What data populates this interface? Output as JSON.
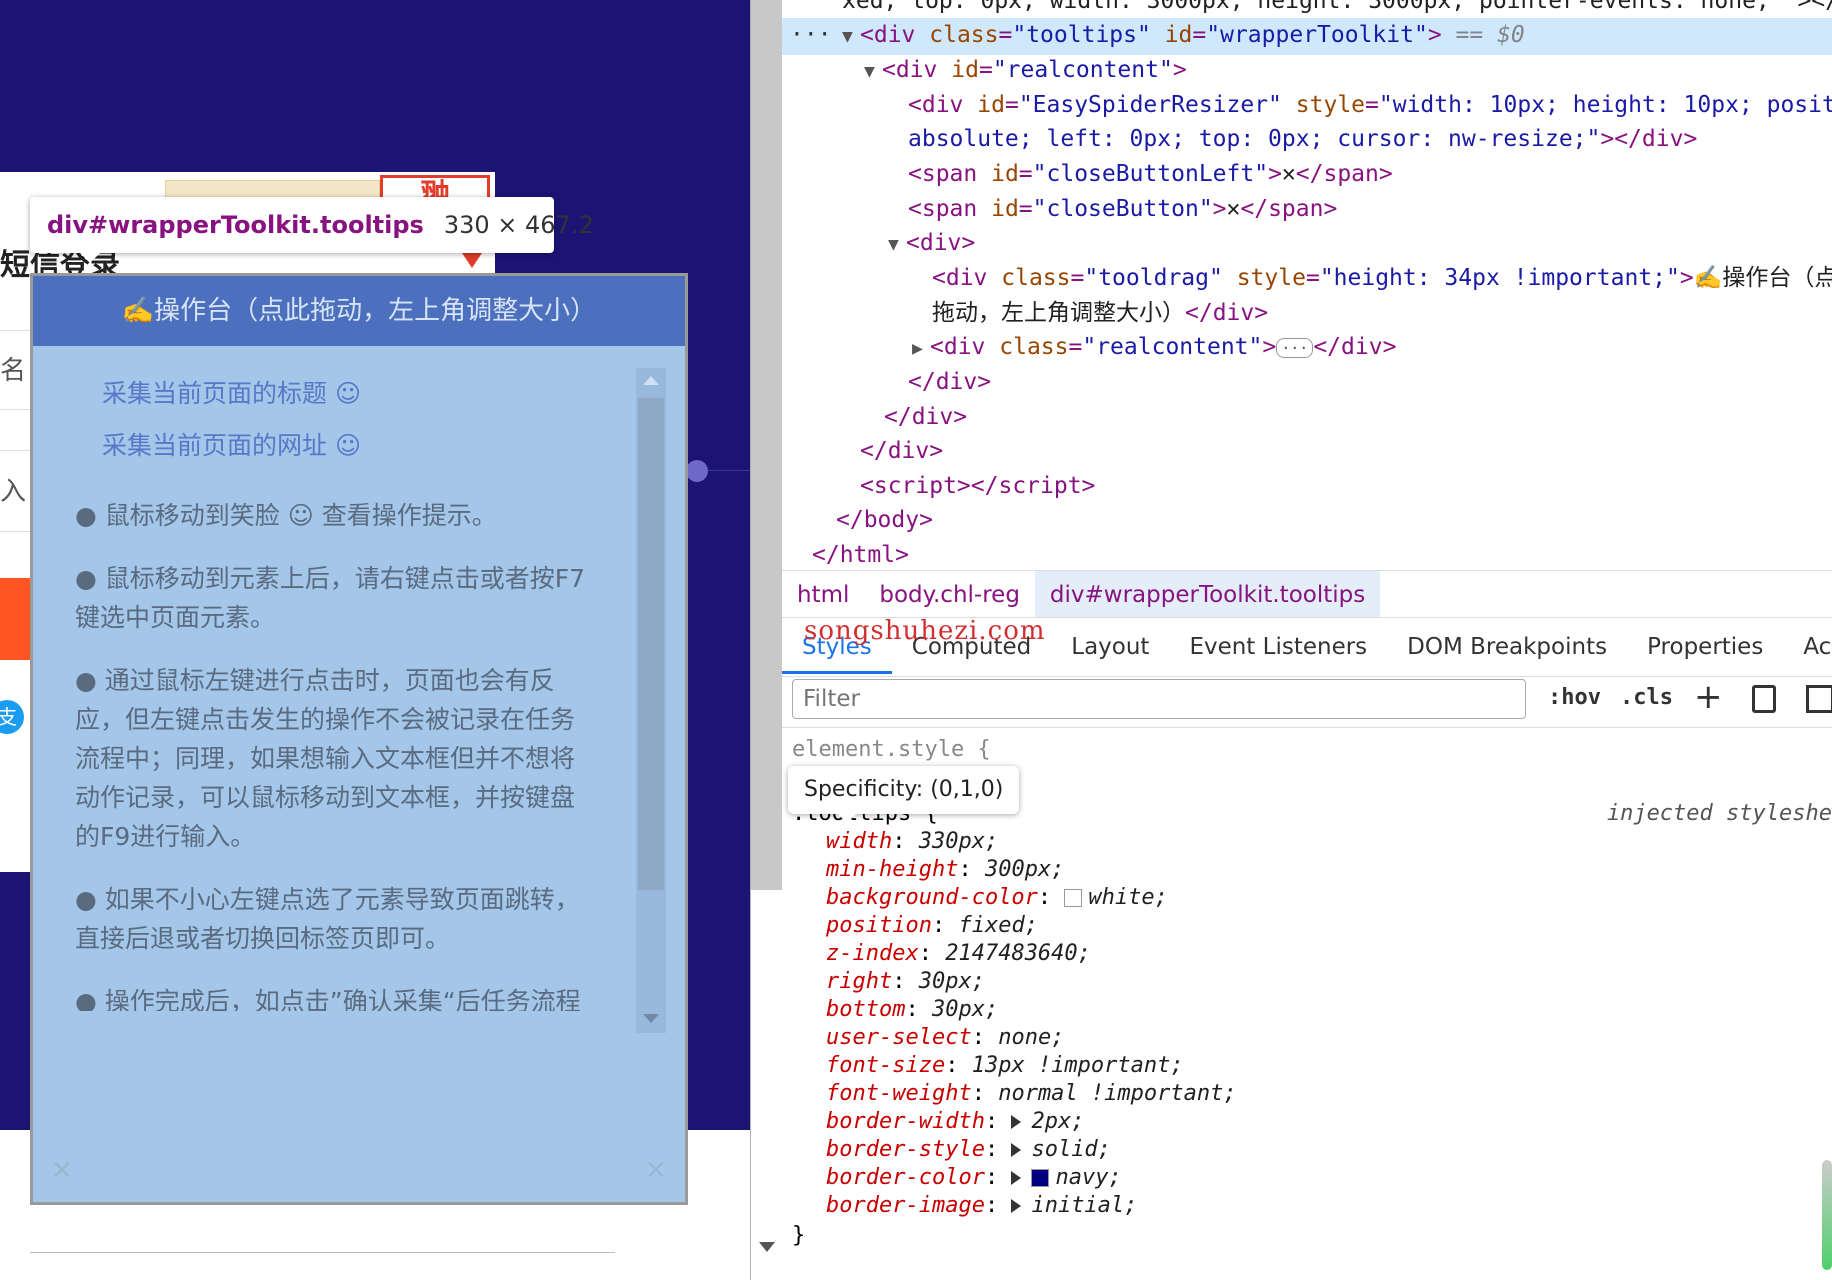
{
  "page": {
    "card_title": "短信登录",
    "logo_text": "翀",
    "input1_text": "名",
    "input2_text": "入",
    "badge_text": "支"
  },
  "hover_label": {
    "selector": "div#wrapperToolkit.tooltips",
    "dimensions": "330 × 467.2"
  },
  "toolkit": {
    "drag_title": "✍️操作台（点此拖动，左上角调整大小）",
    "links": [
      "采集当前页面的标题 ☺",
      "采集当前页面的网址 ☺"
    ],
    "paragraphs": [
      "● 鼠标移动到笑脸 ☺ 查看操作提示。",
      "● 鼠标移动到元素上后，请右键点击或者按F7键选中页面元素。",
      "● 通过鼠标左键进行点击时，页面也会有反应，但左键点击发生的操作不会被记录在任务流程中；同理，如果想输入文本框但并不想将动作记录，可以鼠标移动到文本框，并按键盘的F9进行输入。",
      "● 如果不小心左键点选了元素导致页面跳转，直接后退或者切换回标签页即可。",
      "● 操作完成后，如点击”确认采集“后任务流程图中没有”提取数据“操作被添加，重试一次即可。"
    ],
    "close_left": "✕",
    "close_right": "✕"
  },
  "dom": {
    "line0": "xed; top: 0px; width: 3000px; height: 3000px; pointer-events: none; \"></di",
    "sel_row_dots": "···",
    "sel_tag_open": "<div ",
    "sel_attr1_name": "class",
    "sel_attr1_val": "\"tooltips\"",
    "sel_attr2_name": "id",
    "sel_attr2_val": "\"wrapperToolkit\"",
    "sel_tag_close": ">",
    "sel_eq": " == $0",
    "realcontent_open": "<div ",
    "realcontent_attr": "id",
    "realcontent_val": "\"realcontent\"",
    "resizer_attr": "id",
    "resizer_val": "\"EasySpiderResizer\"",
    "resizer_style_name": "style",
    "resizer_style_val1": "\"width: 10px; height: 10px; position:",
    "resizer_style_val2": "absolute; left: 0px; top: 0px; cursor: nw-resize;\"",
    "close_left_id": "\"closeButtonLeft\"",
    "close_right_id": "\"closeButton\"",
    "close_char": "✕",
    "tooldrag_class": "\"tooldrag\"",
    "tooldrag_style": "\"height: 34px !important;\"",
    "tooldrag_text1": "✍️操作台（点此",
    "tooldrag_text2": "拖动，左上角调整大小）",
    "realcontent_class": "\"realcontent\"",
    "ellipsis": "···"
  },
  "crumbs": [
    "html",
    "body.chl-reg",
    "div#wrapperToolkit.tooltips"
  ],
  "tabs": [
    "Styles",
    "Computed",
    "Layout",
    "Event Listeners",
    "DOM Breakpoints",
    "Properties",
    "Accessibi"
  ],
  "watermark": "songshuhezi.com",
  "filter": {
    "placeholder": "Filter",
    "hov": ":hov",
    "cls": ".cls",
    "plus": "+"
  },
  "styles": {
    "element_style": "element.style {",
    "selector": ".tooltips {",
    "source": "injected styleshe",
    "specificity": "Specificity: (0,1,0)",
    "props": [
      {
        "name": "width",
        "value": "330px;"
      },
      {
        "name": "min-height",
        "value": "300px;"
      },
      {
        "name": "background-color",
        "value": "white;"
      },
      {
        "name": "position",
        "value": "fixed;"
      },
      {
        "name": "z-index",
        "value": "2147483640;"
      },
      {
        "name": "right",
        "value": "30px;"
      },
      {
        "name": "bottom",
        "value": "30px;"
      },
      {
        "name": "user-select",
        "value": "none;"
      },
      {
        "name": "font-size",
        "value": "13px !important;"
      },
      {
        "name": "font-weight",
        "value": "normal !important;"
      },
      {
        "name": "border-width",
        "value": "2px;"
      },
      {
        "name": "border-style",
        "value": "solid;"
      },
      {
        "name": "border-color",
        "value": "navy;"
      },
      {
        "name": "border-image",
        "value": "initial;"
      }
    ],
    "close": "}",
    "swatch_white": "#ffffff",
    "swatch_navy": "#000080"
  }
}
